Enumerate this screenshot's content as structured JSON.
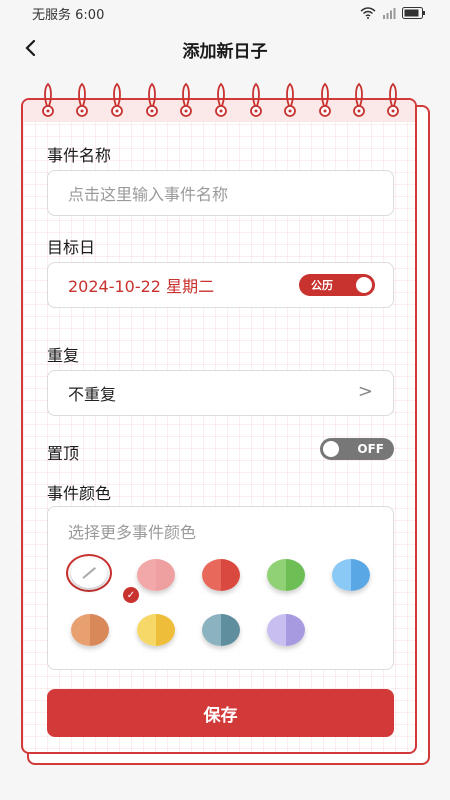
{
  "status_bar": {
    "carrier": "无服务",
    "time": "6:00"
  },
  "nav": {
    "title": "添加新日子"
  },
  "form": {
    "event_name_label": "事件名称",
    "event_name_placeholder": "点击这里输入事件名称",
    "target_date_label": "目标日",
    "target_date_value": "2024-10-22 星期二",
    "calendar_toggle_label": "公历",
    "repeat_label": "重复",
    "repeat_value": "不重复",
    "repeat_chevron": ">",
    "pin_label": "置顶",
    "pin_toggle_label": "OFF",
    "pin_on": false,
    "color_label": "事件颜色",
    "color_hint": "选择更多事件颜色",
    "selected_color_index": 0,
    "save_label": "保存"
  },
  "colors": {
    "accent": "#d23a3a",
    "swatches": [
      [
        "#ffffff",
        "#ffffff"
      ],
      [
        "#f2a8a8",
        "#eea0a0"
      ],
      [
        "#e8695c",
        "#d9493f"
      ],
      [
        "#8fd174",
        "#6dbf55"
      ],
      [
        "#8ac8f5",
        "#5aa7e6"
      ],
      [
        "#e8a070",
        "#d9885a"
      ],
      [
        "#f5d868",
        "#eebe3a"
      ],
      [
        "#8ab2bf",
        "#5f8e9e"
      ],
      [
        "#c8bff0",
        "#a89ae0"
      ]
    ]
  }
}
